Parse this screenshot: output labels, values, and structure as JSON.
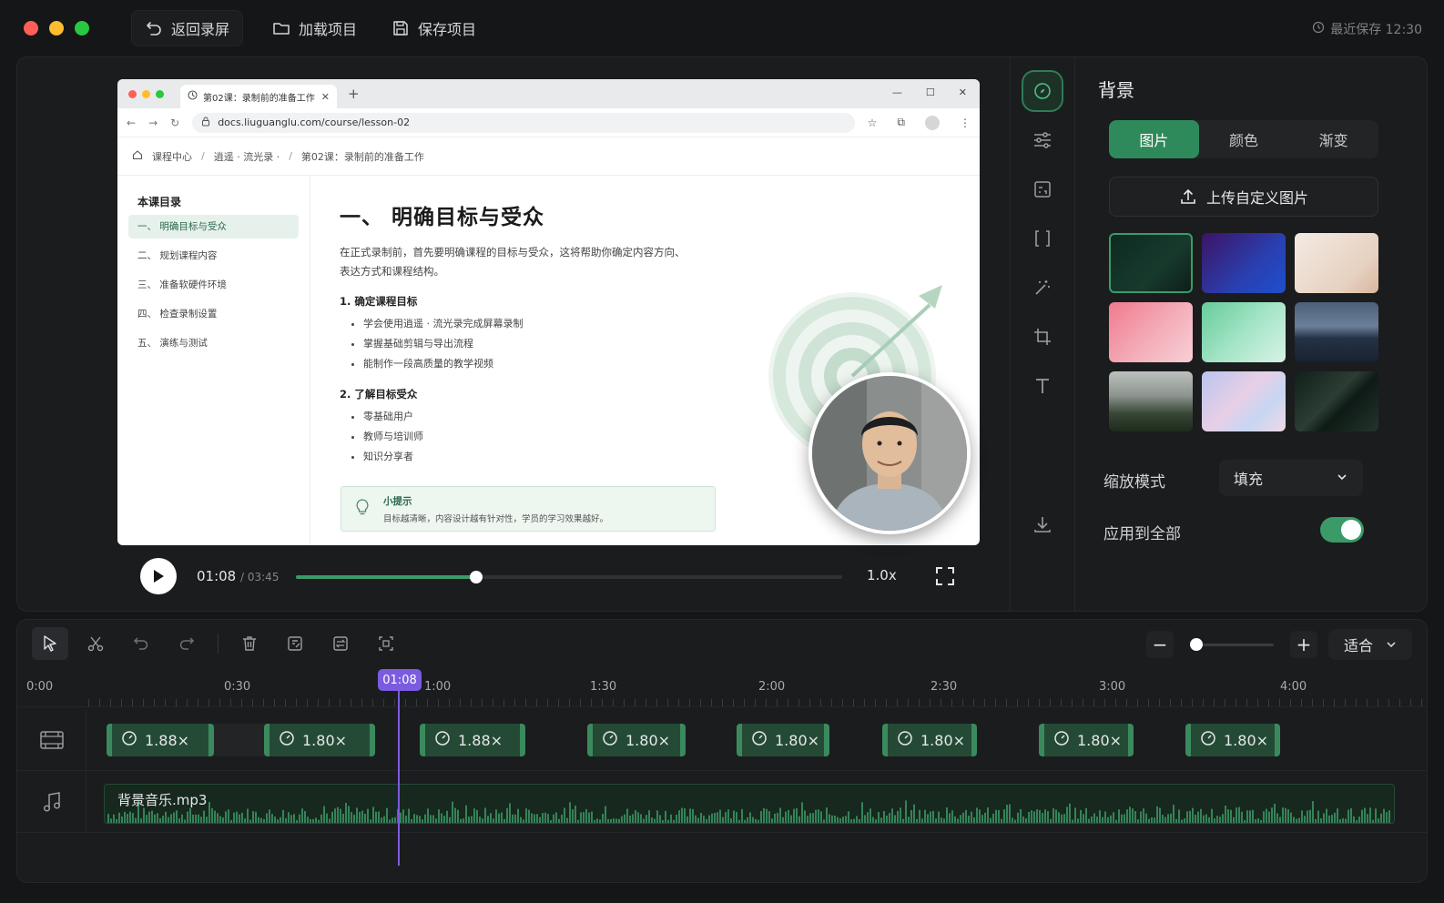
{
  "window": {
    "traffic_colors": [
      "#ff5f57",
      "#febc2e",
      "#28c840"
    ]
  },
  "toolbar": {
    "back_label": "返回录屏",
    "load_label": "加载项目",
    "save_label": "保存项目",
    "last_saved": "最近保存 12:30"
  },
  "browser": {
    "tab_title": "第02课：录制前的准备工作",
    "url": "docs.liuguanglu.com/course/lesson-02",
    "breadcrumb": [
      "课程中心",
      "逍遥 · 流光录 ·",
      "第02课：录制前的准备工作"
    ],
    "toc_title": "本课目录",
    "toc": [
      "一、 明确目标与受众",
      "二、 规划课程内容",
      "三、 准备软硬件环境",
      "四、 检查录制设置",
      "五、 演练与测试"
    ],
    "heading": "一、 明确目标与受众",
    "intro": "在正式录制前，首先要明确课程的目标与受众，这将帮助你确定内容方向、表达方式和课程结构。",
    "section1_title": "1. 确定课程目标",
    "section1_items": [
      "学会使用逍遥 · 流光录完成屏幕录制",
      "掌握基础剪辑与导出流程",
      "能制作一段高质量的教学视频"
    ],
    "section2_title": "2. 了解目标受众",
    "section2_items": [
      "零基础用户",
      "教师与培训师",
      "知识分享者"
    ],
    "tip_title": "小提示",
    "tip_text": "目标越清晰，内容设计越有针对性，学员的学习效果越好。"
  },
  "player": {
    "current": "01:08",
    "total": "/ 03:45",
    "progress_fraction": 0.33,
    "speed": "1.0x"
  },
  "panel": {
    "title": "背景",
    "tabs": [
      "图片",
      "颜色",
      "渐变"
    ],
    "upload_label": "上传自定义图片",
    "scale_label": "缩放模式",
    "scale_value": "填充",
    "apply_all_label": "应用到全部",
    "apply_all_on": true
  },
  "timeline": {
    "fit_label": "适合",
    "ticks": [
      "0:00",
      "0:30",
      "1:00",
      "1:30",
      "2:00",
      "2:30",
      "3:00",
      "4:00"
    ],
    "playhead_label": "01:08",
    "clips": [
      "1.88×",
      "1.80×",
      "1.88×",
      "1.80×",
      "1.80×",
      "1.80×",
      "1.80×",
      "1.80×"
    ],
    "audio_label": "背景音乐.mp3"
  },
  "colors": {
    "accent": "#2f8a5b",
    "playhead": "#7b5ce0"
  }
}
